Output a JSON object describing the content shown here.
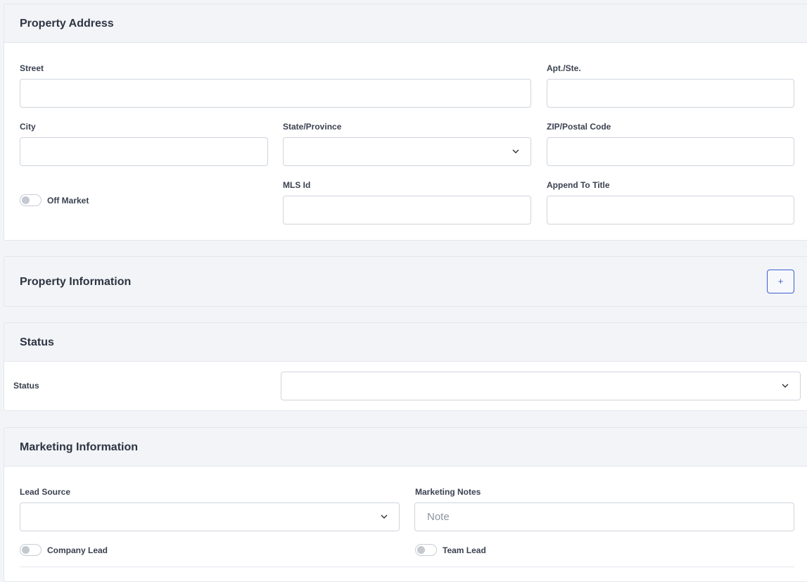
{
  "property_address": {
    "title": "Property Address",
    "street_label": "Street",
    "apt_label": "Apt./Ste.",
    "city_label": "City",
    "state_label": "State/Province",
    "zip_label": "ZIP/Postal Code",
    "off_market_label": "Off Market",
    "mls_label": "MLS Id",
    "append_title_label": "Append To Title"
  },
  "property_information": {
    "title": "Property Information",
    "add_label": "+"
  },
  "status": {
    "title": "Status",
    "status_label": "Status"
  },
  "marketing": {
    "title": "Marketing Information",
    "lead_source_label": "Lead Source",
    "notes_label": "Marketing Notes",
    "notes_placeholder": "Note",
    "company_lead_label": "Company Lead",
    "team_lead_label": "Team Lead"
  }
}
